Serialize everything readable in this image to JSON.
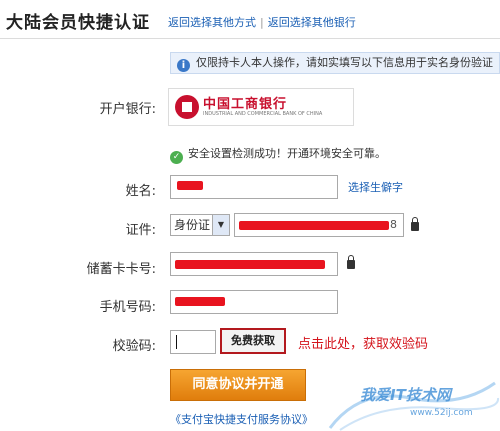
{
  "header": {
    "title": "大陆会员快捷认证",
    "link_other_method": "返回选择其他方式",
    "separator": "|",
    "link_other_bank": "返回选择其他银行"
  },
  "notice": {
    "text": "仅限持卡人本人操作，请如实填写以下信息用于实名身份验证",
    "icon": "info-icon"
  },
  "bank": {
    "label": "开户银行:",
    "name_cn": "中国工商银行",
    "name_en": "INDUSTRIAL AND COMMERCIAL BANK OF CHINA"
  },
  "security": {
    "text": "安全设置检测成功！开通环境安全可靠。",
    "icon": "check-circle-icon"
  },
  "form": {
    "name_label": "姓名:",
    "name_value": "",
    "rare_char_link": "选择生僻字",
    "id_label": "证件:",
    "id_type": "身份证",
    "id_value_suffix": "8",
    "card_label": "储蓄卡卡号:",
    "phone_label": "手机号码:",
    "code_label": "校验码:",
    "get_code_button": "免费获取",
    "hint": "点击此处，获取效验码",
    "submit_button": "同意协议并开通",
    "agreement_link": "《支付宝快捷支付服务协议》"
  },
  "watermark": {
    "text": "我爱IT技术网",
    "url": "www.52ij.com"
  },
  "colors": {
    "link": "#1a5fb4",
    "redaction": "#e8141f",
    "submit": "#f0931f",
    "highlight": "#b3191e"
  }
}
